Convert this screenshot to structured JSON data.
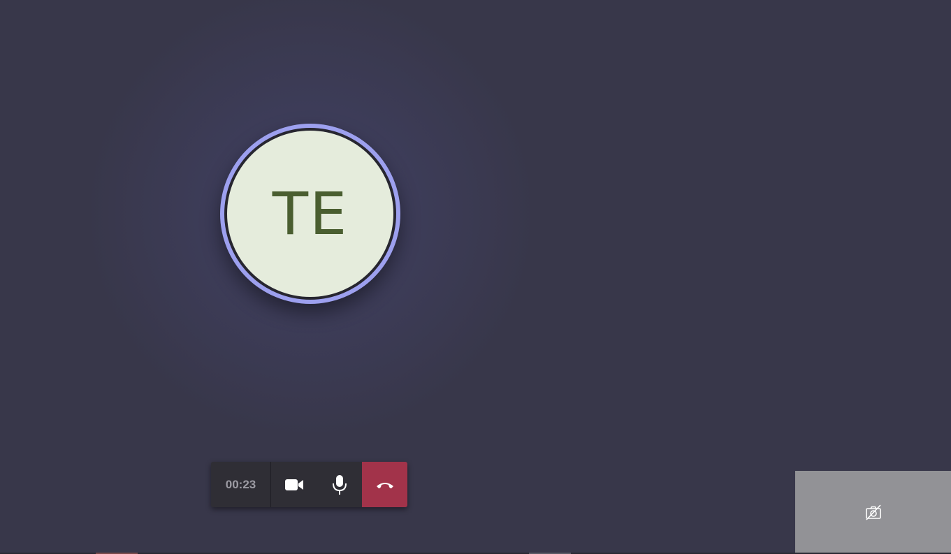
{
  "call": {
    "initials": "TE",
    "duration": "00:23"
  },
  "controls": {
    "video_icon": "video-camera-icon",
    "mic_icon": "microphone-icon",
    "hangup_icon": "phone-hangup-icon"
  },
  "self_view": {
    "icon": "camera-off-icon"
  },
  "colors": {
    "background": "#38374a",
    "avatar_ring": "#9da0ef",
    "avatar_fill": "#e5ecdc",
    "avatar_text": "#4a5e30",
    "control_bar": "#2f2e35",
    "hangup": "#a2334a",
    "self_view": "#929296"
  }
}
